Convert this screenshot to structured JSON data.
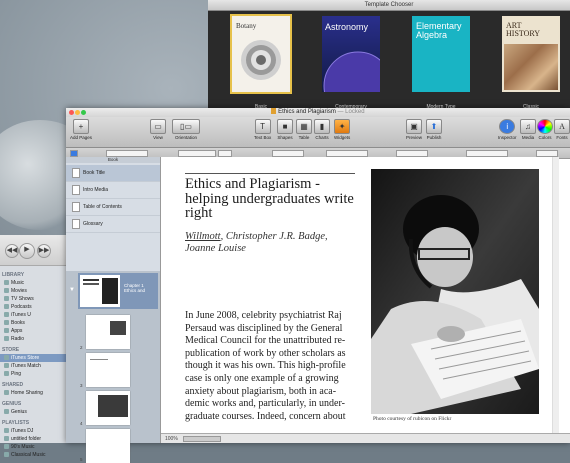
{
  "template_chooser": {
    "title": "Template Chooser",
    "templates": [
      {
        "label": "Basic",
        "cover_title": "Botany"
      },
      {
        "label": "Contemporary",
        "cover_title": "Astronomy"
      },
      {
        "label": "Modern Type",
        "cover_title": "Elementary Algebra"
      },
      {
        "label": "Classic",
        "cover_title": "ART HISTORY"
      }
    ]
  },
  "ibooks": {
    "window_title": "Ethics and Plagiarism",
    "locked": "— Locked",
    "toolbar": {
      "add_pages": "Add Pages",
      "view": "View",
      "orientation": "Orientation",
      "text_box": "Text Box",
      "shapes": "Shapes",
      "table": "Table",
      "charts": "Charts",
      "widgets": "Widgets",
      "preview": "Preview",
      "publish": "Publish",
      "inspector": "Inspector",
      "media": "Media",
      "colors": "Colors",
      "fonts": "Fonts"
    },
    "sidebar": {
      "header": "Book",
      "items": [
        "Book Title",
        "Intro Media",
        "Table of Contents",
        "Glossary"
      ],
      "chapter": "Chapter 1 Ethics and",
      "page_numbers": [
        "2",
        "3",
        "4",
        "5"
      ]
    },
    "page": {
      "title": "Ethics and Plagiarism - helping undergraduates write right",
      "author_link": "Willmott",
      "author_rest": ", Christopher J.R. Badge, Joanne Louise",
      "body": "In June 2008, celebrity psychiatrist Raj Persaud was disciplined by the General Medical Council for the unattributed re-publication of work by other scholars as though it was his own. This high-profile case is only one example of a growing anxiety about plagiarism, both in aca-demic works and, particularly, in under-graduate courses. Indeed, concern about",
      "caption": "Photo courtesy of rubicon on Flickr"
    },
    "zoom": "100%"
  },
  "itunes": {
    "sections": [
      {
        "header": "LIBRARY",
        "items": [
          "Music",
          "Movies",
          "TV Shows",
          "Podcasts",
          "iTunes U",
          "Books",
          "Apps",
          "Radio"
        ]
      },
      {
        "header": "STORE",
        "items": [
          "iTunes Store",
          "iTunes Match",
          "Ping"
        ]
      },
      {
        "header": "SHARED",
        "items": [
          "Home Sharing"
        ]
      },
      {
        "header": "GENIUS",
        "items": [
          "Genius"
        ]
      },
      {
        "header": "PLAYLISTS",
        "items": [
          "iTunes DJ",
          "untitled folder",
          "90's Music",
          "Classical Music"
        ]
      }
    ],
    "selected": "iTunes Store"
  },
  "colors": {
    "basic_border": "#e6c14a",
    "chapter_sel": "#7f97b8",
    "teal_cover": "#19b4c4",
    "astro_cover": "#2a2f8c"
  }
}
